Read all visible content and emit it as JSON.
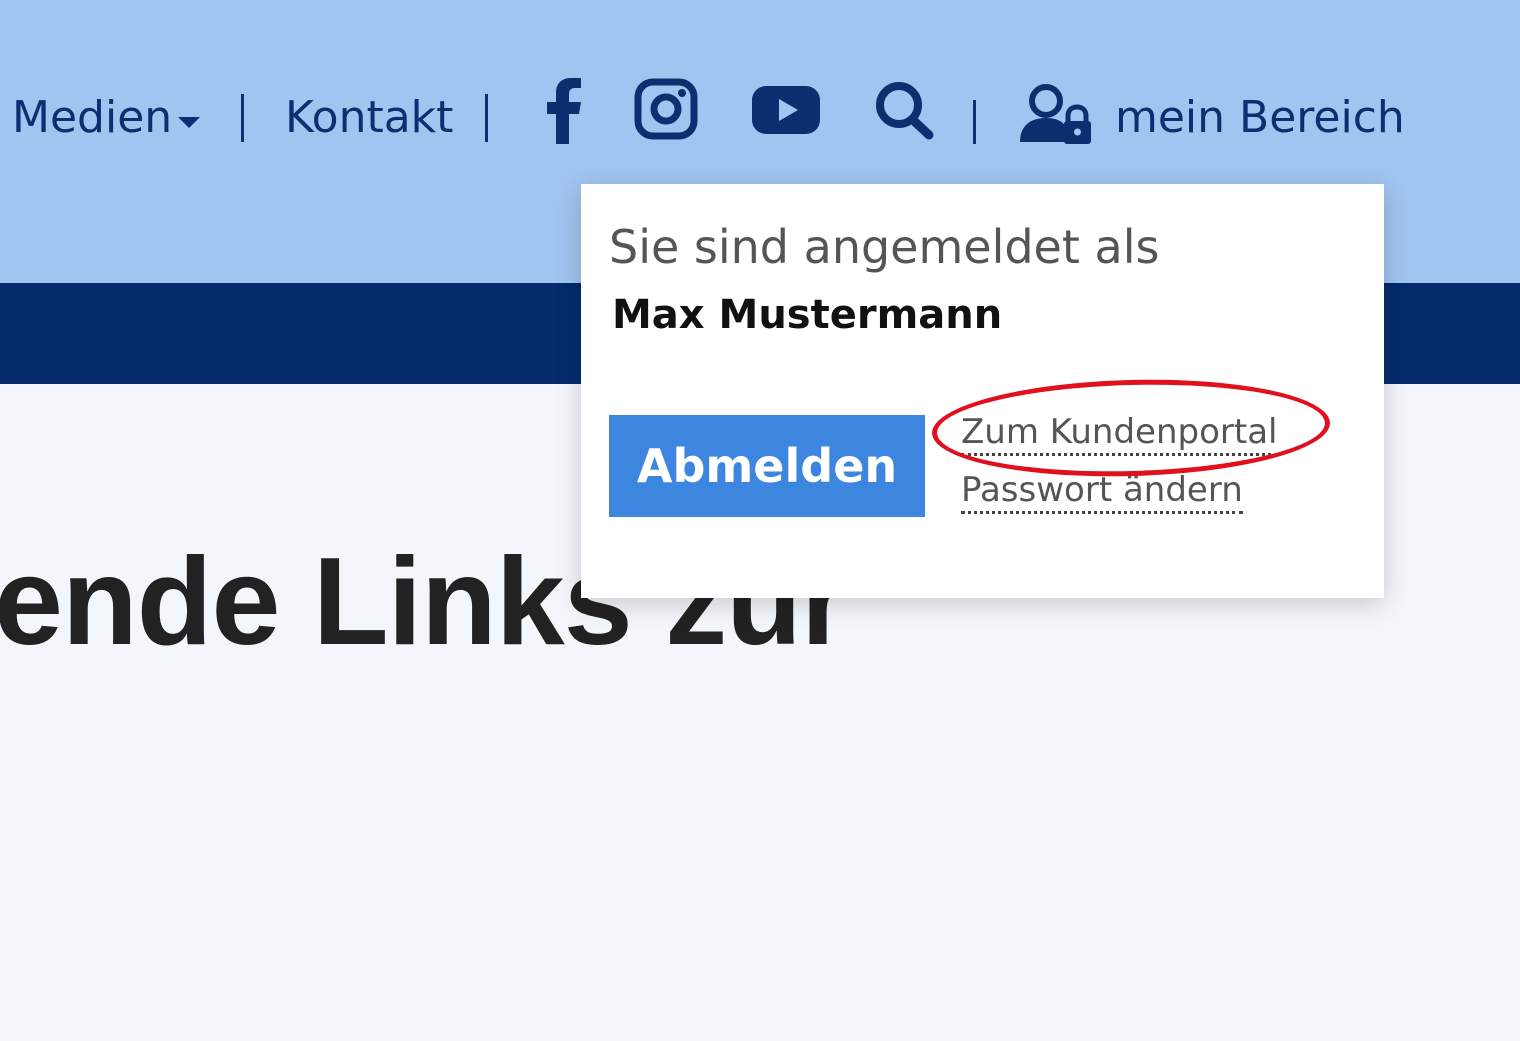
{
  "nav": {
    "media_label": "Medien",
    "contact_label": "Kontakt",
    "account_label": "mein Bereich"
  },
  "icons": [
    "facebook-icon",
    "instagram-icon",
    "youtube-icon",
    "search-icon",
    "user-lock-icon",
    "caret-down-icon"
  ],
  "popup": {
    "intro": "Sie sind angemeldet als",
    "username": "Max Mustermann",
    "logout_label": "Abmelden",
    "portal_link": "Zum Kundenportal",
    "password_link": "Passwort ändern"
  },
  "page": {
    "headline_fragment": "ende Links zur"
  },
  "colors": {
    "header_bg": "#a0c5f0",
    "nav_text": "#0d2f6f",
    "dark_band": "#052b6d",
    "button": "#3d86e0",
    "annotation": "#e0101e",
    "page_bg": "#f3f6fa"
  }
}
